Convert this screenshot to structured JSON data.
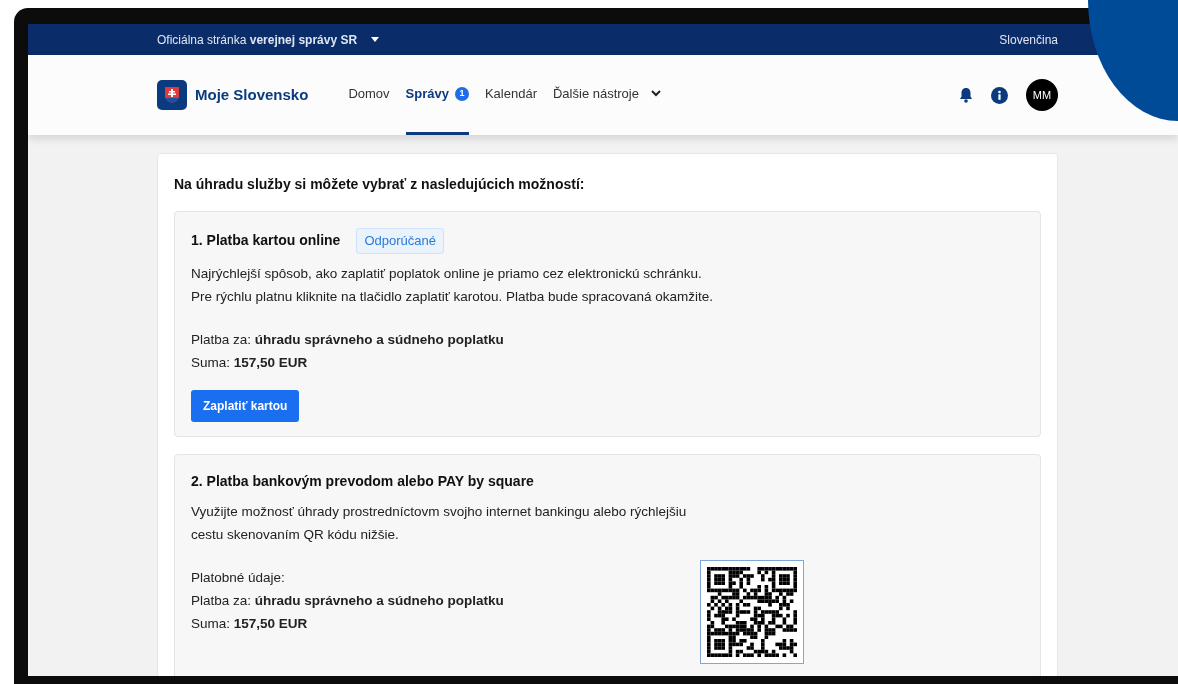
{
  "topbar": {
    "official_text": "Oficiálna stránka **verejnej správy SR**",
    "language": "Slovenčina"
  },
  "header": {
    "brand": "Moje Slovensko",
    "nav": [
      {
        "label": "Domov",
        "selected": false,
        "kind": "link"
      },
      {
        "label": "Správy",
        "selected": true,
        "kind": "link",
        "badge": "1"
      },
      {
        "label": "Kalendár",
        "selected": false,
        "kind": "link"
      },
      {
        "label": "Ďalšie nástroje",
        "selected": false,
        "kind": "dropdown"
      }
    ],
    "avatar": "MM"
  },
  "content": {
    "heading": "Na úhradu služby si môžete vybrať z nasledujúcich možností:",
    "options": [
      {
        "title": "1. Platba kartou online",
        "tag": "Odporúčané",
        "description": "Najrýchlejší  spôsob, ako zaplatiť poplatok online je priamo cez elektronickú schránku.\nPre rýchlu platnu kliknite na tlačidlo zaplatiť karotou. Platba bude spracovaná okamžite.",
        "details": [
          "Platba za: **úhradu správneho a súdneho poplatku**",
          "Suma: **157,50 EUR**"
        ],
        "button": "Zaplatiť kartou",
        "kind": "card"
      },
      {
        "title": "2. Platba bankovým prevodom alebo PAY by square",
        "description": "Využijte možnosť úhrady prostredníctovm svojho internet bankingu alebo rýchlejšiu cestu skenovaním QR kódu nižšie.",
        "details": [
          "Platobné údaje:",
          "Platba za: **úhradu správneho a súdneho poplatku**",
          "Suma: **157,50 EUR**"
        ],
        "kind": "bank_transfer"
      }
    ]
  }
}
